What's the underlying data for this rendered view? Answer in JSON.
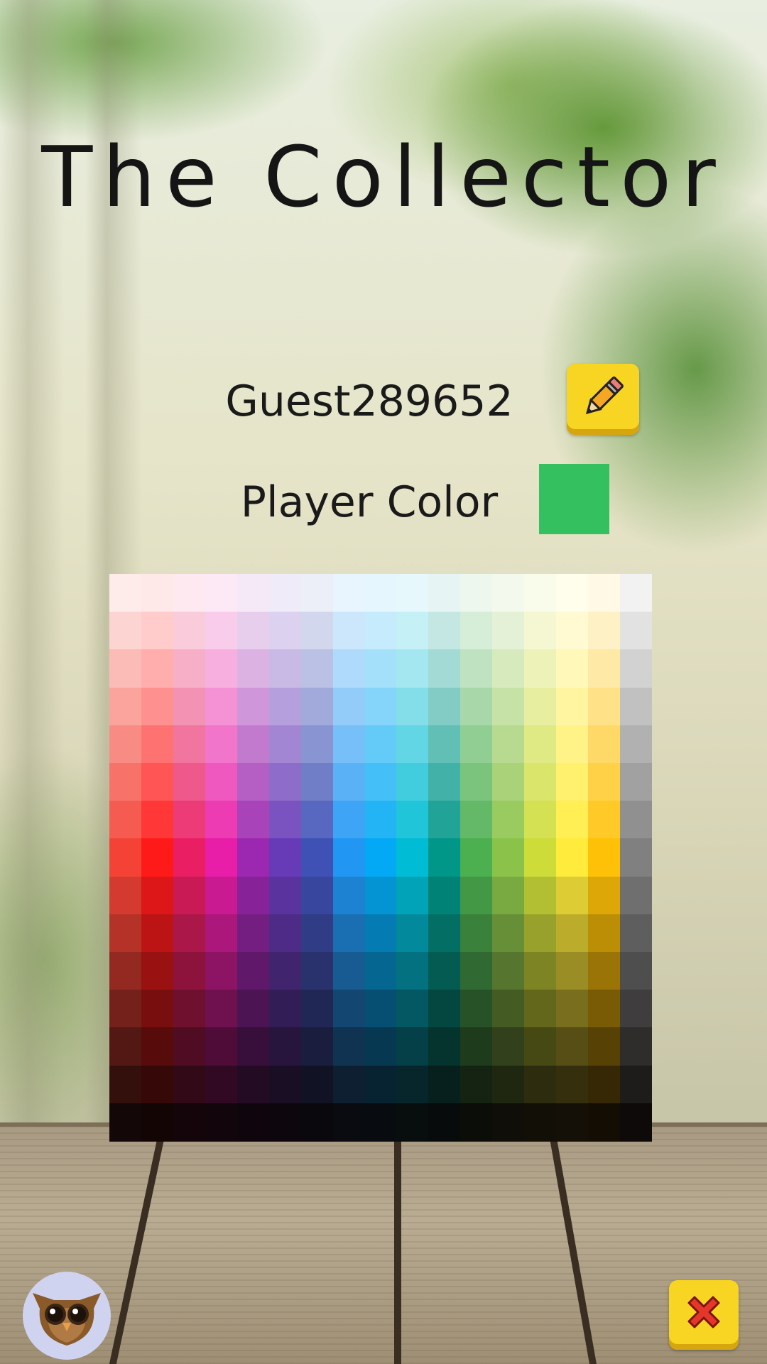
{
  "app": {
    "title": "The Collector"
  },
  "player": {
    "name": "Guest289652",
    "color_label": "Player Color",
    "selected_color": "#35c05f"
  },
  "buttons": {
    "edit_icon": "pencil-icon",
    "close_icon": "close-x-icon",
    "avatar_icon": "owl-icon"
  },
  "palette": {
    "columns": [
      "#f44336",
      "#ff1a1a",
      "#e91e63",
      "#e91ea8",
      "#9c27b0",
      "#673ab7",
      "#3f51b5",
      "#2196f3",
      "#03a9f4",
      "#00bcd4",
      "#009688",
      "#4caf50",
      "#8bc34a",
      "#cddc39",
      "#ffeb3b",
      "#ffc107",
      "#808080"
    ],
    "rows": 15
  }
}
